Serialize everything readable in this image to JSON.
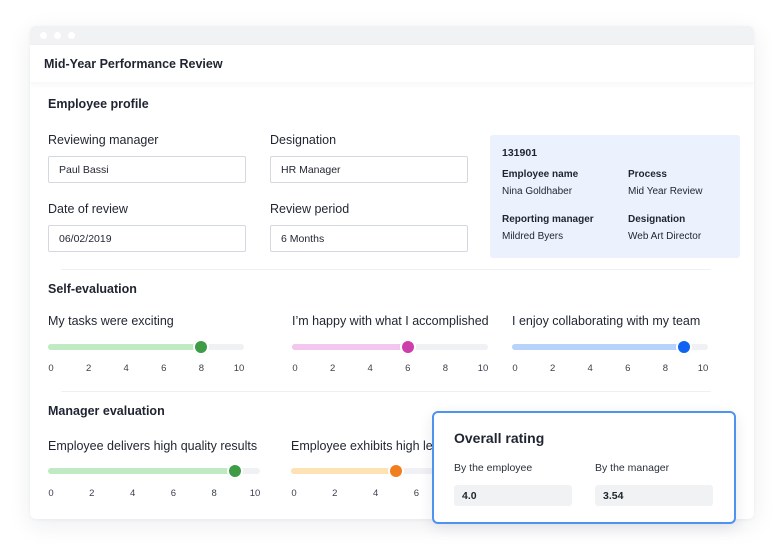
{
  "window": {
    "title": "Mid-Year Performance Review"
  },
  "profile": {
    "section_title": "Employee profile",
    "fields": [
      {
        "label": "Reviewing manager",
        "value": "Paul Bassi"
      },
      {
        "label": "Designation",
        "value": "HR Manager"
      },
      {
        "label": "Date of review",
        "value": "06/02/2019"
      },
      {
        "label": "Review period",
        "value": "6 Months"
      }
    ],
    "card": {
      "id": "131901",
      "items": [
        {
          "key": "Employee name",
          "value": "Nina Goldhaber"
        },
        {
          "key": "Process",
          "value": "Mid Year Review"
        },
        {
          "key": "Reporting manager",
          "value": "Mildred Byers"
        },
        {
          "key": "Designation",
          "value": "Web Art Director"
        }
      ]
    }
  },
  "self_evaluation": {
    "section_title": "Self-evaluation",
    "scale": {
      "min": 0,
      "max": 10,
      "ticks": [
        "0",
        "2",
        "4",
        "6",
        "8",
        "10"
      ]
    },
    "sliders": [
      {
        "label": "My tasks were exciting",
        "value": 8,
        "fill_color": "#bfeac3",
        "thumb_color": "#3e9c47"
      },
      {
        "label": "I’m happy with what I accomplished",
        "value": 6,
        "fill_color": "#f3c6ee",
        "thumb_color": "#cc3eab"
      },
      {
        "label": "I enjoy collaborating with my team",
        "value": 9,
        "fill_color": "#b7d3fb",
        "thumb_color": "#0f63f0"
      }
    ]
  },
  "manager_evaluation": {
    "section_title": "Manager evaluation",
    "scale": {
      "min": 0,
      "max": 10,
      "ticks": [
        "0",
        "2",
        "4",
        "6",
        "8",
        "10"
      ]
    },
    "sliders": [
      {
        "label": "Employee delivers high quality results",
        "value": 9,
        "fill_color": "#bfeac3",
        "thumb_color": "#3e9c47"
      },
      {
        "label": "Employee exhibits high le",
        "value": 5,
        "fill_color": "#fde2b3",
        "thumb_color": "#f27d1e"
      }
    ]
  },
  "overall_rating": {
    "title": "Overall rating",
    "by_employee_label": "By the employee",
    "by_employee_value": "4.0",
    "by_manager_label": "By the manager",
    "by_manager_value": "3.54"
  },
  "colors": {
    "accent_border": "#4f93f0",
    "info_card_bg": "#ebf2fe"
  }
}
